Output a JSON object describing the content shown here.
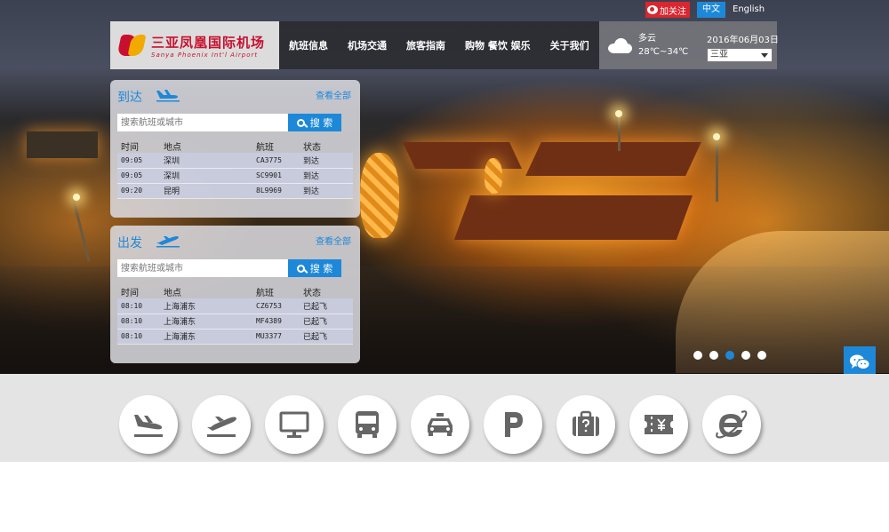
{
  "top_links": {
    "weibo_follow": "加关注",
    "lang_cn": "中文",
    "lang_en": "English"
  },
  "brand": {
    "name_cn": "三亚凤凰国际机场",
    "name_en": "Sanya Phoenix Int'l Airport"
  },
  "nav": {
    "items": [
      "航班信息",
      "机场交通",
      "旅客指南",
      "购物 餐饮 娱乐",
      "关于我们"
    ]
  },
  "weather": {
    "icon": "cloud-icon",
    "condition": "多云",
    "temperature": "28℃~34℃"
  },
  "date_box": {
    "date": "2016年06月03日",
    "city_selected": "三亚"
  },
  "arrivals": {
    "title": "到达",
    "icon": "arrival-plane-icon",
    "view_all": "查看全部",
    "search_placeholder": "搜索航班或城市",
    "search_button": "搜 索",
    "columns": [
      "时间",
      "地点",
      "航班",
      "状态"
    ],
    "rows": [
      {
        "time": "09:05",
        "place": "深圳",
        "flight": "CA3775",
        "status": "到达"
      },
      {
        "time": "09:05",
        "place": "深圳",
        "flight": "SC9901",
        "status": "到达"
      },
      {
        "time": "09:20",
        "place": "昆明",
        "flight": "8L9969",
        "status": "到达"
      }
    ]
  },
  "departures": {
    "title": "出发",
    "icon": "departure-plane-icon",
    "view_all": "查看全部",
    "search_placeholder": "搜索航班或城市",
    "search_button": "搜 索",
    "columns": [
      "时间",
      "地点",
      "航班",
      "状态"
    ],
    "rows": [
      {
        "time": "08:10",
        "place": "上海浦东",
        "flight": "CZ6753",
        "status": "已起飞"
      },
      {
        "time": "08:10",
        "place": "上海浦东",
        "flight": "MF4389",
        "status": "已起飞"
      },
      {
        "time": "08:10",
        "place": "上海浦东",
        "flight": "MU3377",
        "status": "已起飞"
      }
    ]
  },
  "carousel": {
    "slide_count": 5,
    "active_index": 2
  },
  "float_buttons": {
    "wechat_icon": "wechat-icon",
    "top_icon": "chevron-up-icon"
  },
  "services": [
    "arrival-plane-icon",
    "departure-plane-icon",
    "monitor-icon",
    "bus-icon",
    "taxi-icon",
    "parking-icon",
    "luggage-icon",
    "ticket-icon",
    "ie-browser-icon"
  ],
  "colors": {
    "accent": "#1e88d8",
    "brand_red": "#c8102e",
    "brand_gold": "#f2a900",
    "band": "#e4e4e4"
  }
}
